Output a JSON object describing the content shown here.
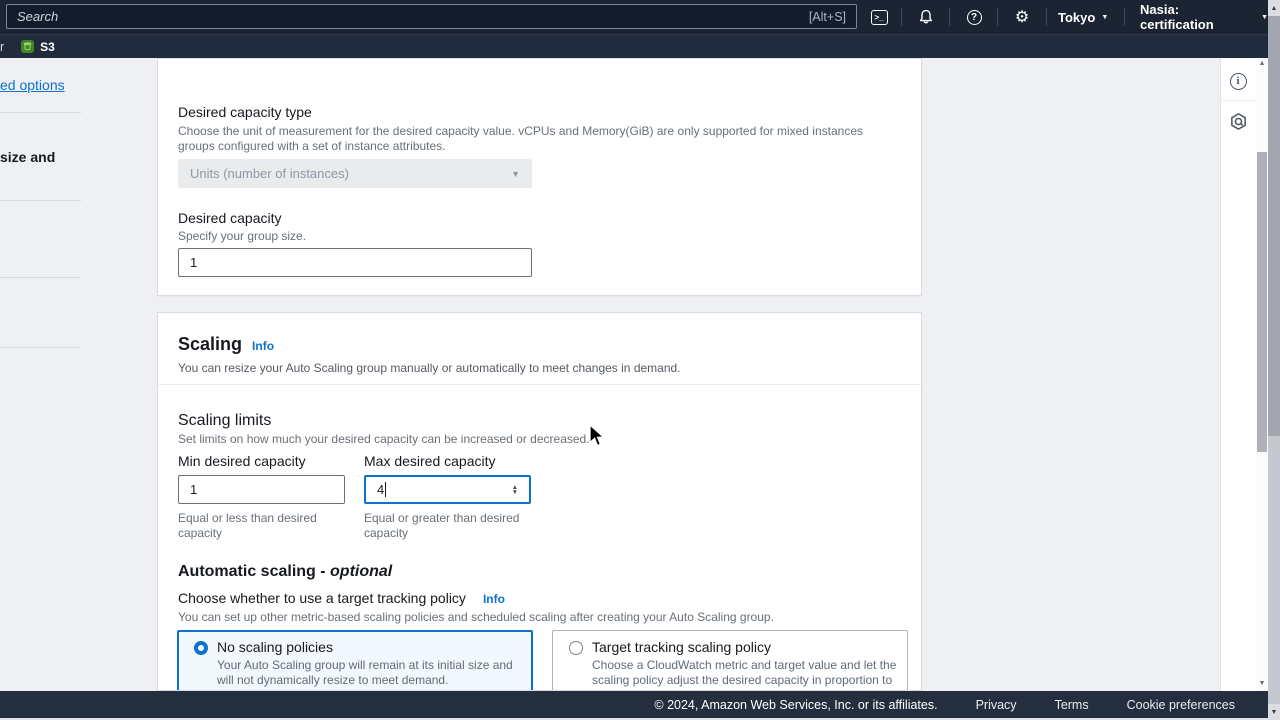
{
  "header": {
    "search": {
      "placeholder": "Search",
      "shortcut": "[Alt+S]"
    },
    "region_label": "Tokyo",
    "account_label": "Nasia: certification",
    "cloudshell_glyph": ">_",
    "help_glyph": "?",
    "gear_glyph": "⚙"
  },
  "favorites_bar": {
    "clipped_item_text": "r",
    "s3_label": "S3"
  },
  "wizard_nav": {
    "clipped_link_text": "ed options",
    "clipped_step_text": "size and"
  },
  "group_size_card": {
    "capacity_type": {
      "label": "Desired capacity type",
      "description": "Choose the unit of measurement for the desired capacity value. vCPUs and Memory(GiB) are only supported for mixed instances groups configured with a set of instance attributes.",
      "selected_option": "Units (number of instances)"
    },
    "desired_capacity": {
      "label": "Desired capacity",
      "description": "Specify your group size.",
      "value": "1"
    }
  },
  "scaling_card": {
    "title": "Scaling",
    "info_label": "Info",
    "description": "You can resize your Auto Scaling group manually or automatically to meet changes in demand.",
    "limits": {
      "title": "Scaling limits",
      "description": "Set limits on how much your desired capacity can be increased or decreased.",
      "min": {
        "label": "Min desired capacity",
        "value": "1",
        "helper": "Equal or less than desired capacity"
      },
      "max": {
        "label": "Max desired capacity",
        "value": "4",
        "helper": "Equal or greater than desired capacity"
      }
    },
    "automatic": {
      "title": "Automatic scaling - ",
      "title_emphasis": "optional",
      "question": "Choose whether to use a target tracking policy",
      "info_label": "Info",
      "description": "You can set up other metric-based scaling policies and scheduled scaling after creating your Auto Scaling group.",
      "options": [
        {
          "label": "No scaling policies",
          "description": "Your Auto Scaling group will remain at its initial size and will not dynamically resize to meet demand.",
          "selected": true
        },
        {
          "label": "Target tracking scaling policy",
          "description": "Choose a CloudWatch metric and target value and let the scaling policy adjust the desired capacity in proportion to changes in demand.",
          "selected": false
        }
      ]
    }
  },
  "footer": {
    "copyright": "© 2024, Amazon Web Services, Inc. or its affiliates.",
    "links": [
      "Privacy",
      "Terms",
      "Cookie preferences"
    ]
  },
  "colors": {
    "accent_blue": "#0972d3",
    "header_bg": "#1b2433",
    "footer_bg": "#232f3e",
    "page_bg": "#eff0f4",
    "s3_green": "#3f8624",
    "disabled_field_bg": "#e9ebed"
  }
}
